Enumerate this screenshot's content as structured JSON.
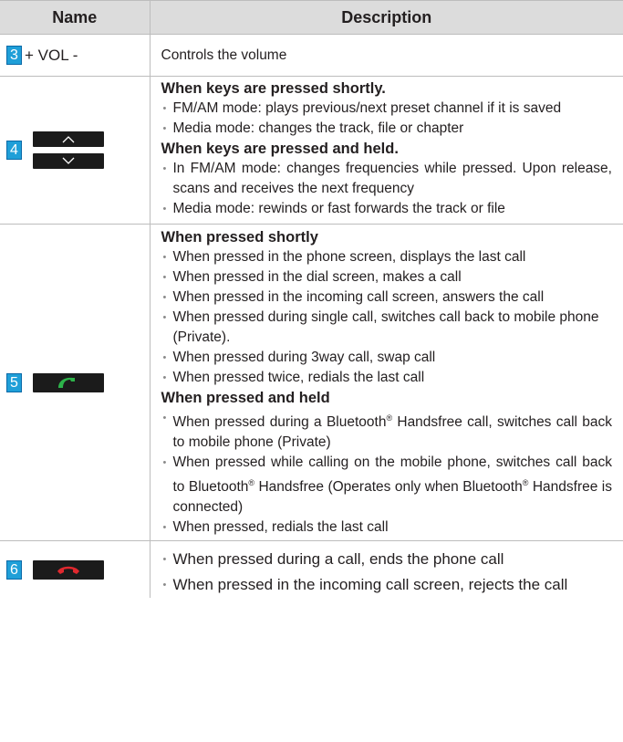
{
  "header": {
    "name": "Name",
    "description": "Description"
  },
  "rows": [
    {
      "number": "3",
      "name_label": "+ VOL -",
      "description": "Controls the volume"
    },
    {
      "number": "4",
      "keys": [
        "chevron-up-icon",
        "chevron-down-icon"
      ],
      "short_heading": "When keys are pressed shortly.",
      "short_items": [
        "FM/AM mode: plays previous/next preset channel if it is saved",
        "Media mode: changes the track, file or chapter"
      ],
      "held_heading": "When keys are pressed and held.",
      "held_items": [
        "In FM/AM mode: changes frequencies while pressed. Upon release, scans and receives the next frequency",
        "Media mode: rewinds or fast forwards the track or file"
      ]
    },
    {
      "number": "5",
      "key_icon": "phone-call-icon",
      "key_icon_color": "#2db34a",
      "short_heading": "When pressed shortly",
      "short_items": [
        "When pressed in the phone screen, displays the last call",
        "When pressed in the dial screen, makes a call",
        "When pressed in the incoming call screen, answers the call",
        "When pressed during single call, switches call back to mobile phone (Private).",
        "When pressed during 3way call, swap call",
        "When pressed twice, redials the last call"
      ],
      "held_heading": "When pressed and held",
      "held_items": [
        "When pressed during a Bluetooth® Handsfree call, switches call back to mobile phone (Private)",
        "When pressed while calling on the mobile phone, switches call back to Bluetooth® Handsfree (Operates only when Bluetooth® Handsfree is connected)",
        "When pressed, redials the last call"
      ]
    },
    {
      "number": "6",
      "key_icon": "phone-end-icon",
      "key_icon_color": "#e0282e",
      "items": [
        "When pressed during a call, ends the phone call",
        "When pressed in the incoming call screen, rejects the call"
      ]
    }
  ],
  "colors": {
    "header_bg": "#dcdcdc",
    "number_badge": "#1f9fd8",
    "key_bg": "#1b1b1b",
    "border": "#bdbdbd"
  }
}
